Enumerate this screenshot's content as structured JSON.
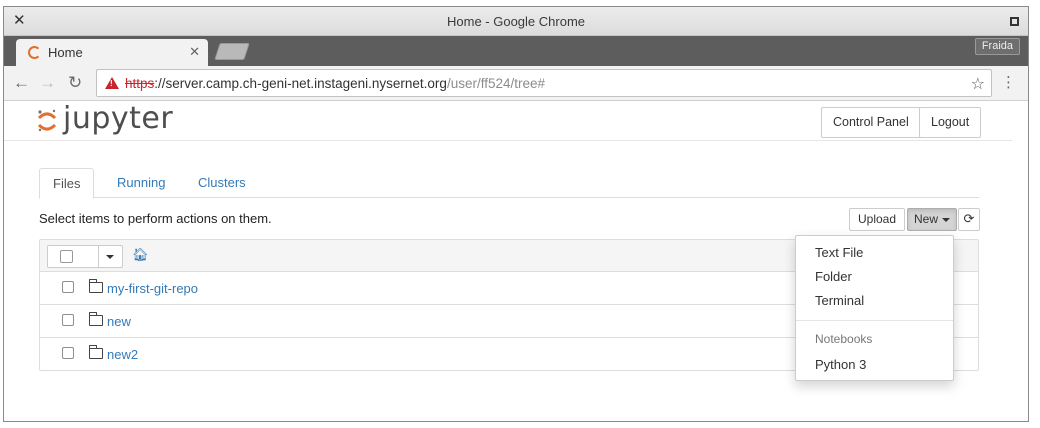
{
  "window": {
    "title": "Home - Google Chrome"
  },
  "browser": {
    "tab_title": "Home",
    "profile_name": "Fraida",
    "url": {
      "scheme": "https",
      "host": "://server.camp.ch-geni-net.instageni.nysernet.org",
      "path": "/user/ff524/tree#"
    }
  },
  "header": {
    "logo_text": "jupyter",
    "control_panel_label": "Control Panel",
    "logout_label": "Logout"
  },
  "tabs": [
    {
      "label": "Files"
    },
    {
      "label": "Running"
    },
    {
      "label": "Clusters"
    }
  ],
  "toolbar": {
    "instructions": "Select items to perform actions on them.",
    "upload_label": "Upload",
    "new_label": "New"
  },
  "files": [
    {
      "name": "my-first-git-repo"
    },
    {
      "name": "new"
    },
    {
      "name": "new2"
    }
  ],
  "new_menu": {
    "items": [
      {
        "label": "Text File"
      },
      {
        "label": "Folder"
      },
      {
        "label": "Terminal"
      }
    ],
    "section_header": "Notebooks",
    "kernels": [
      {
        "label": "Python 3"
      }
    ]
  },
  "colors": {
    "link": "#337ab7",
    "jupyter_orange": "#e46e2e",
    "warning_red": "#c7262c"
  },
  "icons": [
    "close-icon",
    "maximize-icon",
    "back-icon",
    "forward-icon",
    "reload-icon",
    "warning-icon",
    "star-icon",
    "menu-icon",
    "home-icon",
    "folder-icon",
    "refresh-icon",
    "caret-down-icon"
  ]
}
